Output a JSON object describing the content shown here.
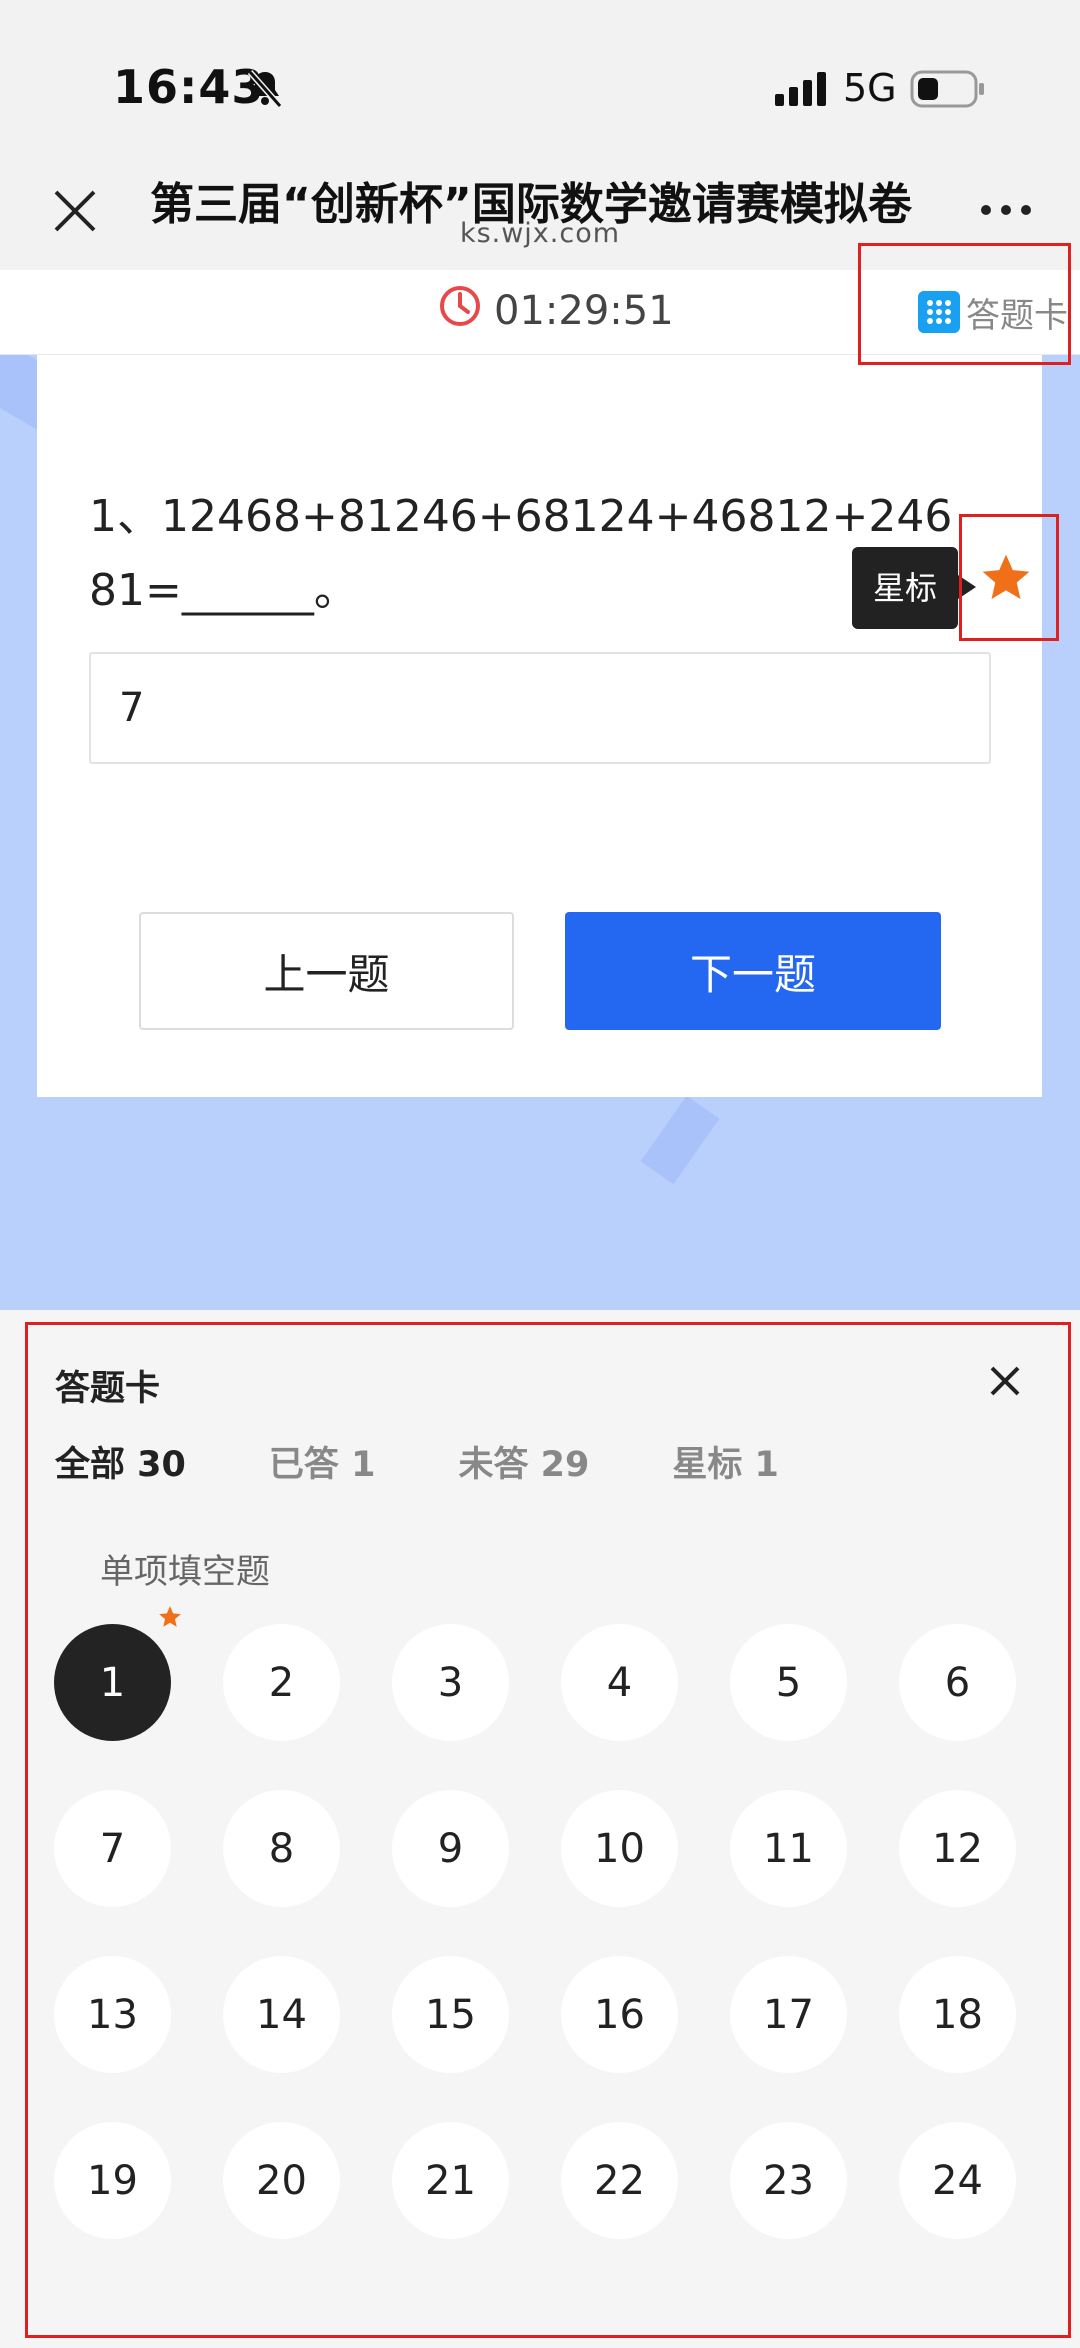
{
  "status_bar": {
    "time": "16:43",
    "network": "5G"
  },
  "nav": {
    "title": "第三届“创新杯”国际数学邀请赛模拟卷",
    "url": "ks.wjx.com"
  },
  "timer": {
    "value": "01:29:51",
    "card_label": "答题卡"
  },
  "question": {
    "text": "1、12468+81246+68124+46812+24681=______。",
    "answer_value": "7",
    "prev_label": "上一题",
    "next_label": "下一题",
    "star_tooltip": "星标"
  },
  "sheet": {
    "title": "答题卡",
    "tabs": [
      {
        "label": "全部 30",
        "active": true
      },
      {
        "label": "已答 1",
        "active": false
      },
      {
        "label": "未答 29",
        "active": false
      },
      {
        "label": "星标 1",
        "active": false
      }
    ],
    "section": "单项填空题",
    "questions": [
      "1",
      "2",
      "3",
      "4",
      "5",
      "6",
      "7",
      "8",
      "9",
      "10",
      "11",
      "12",
      "13",
      "14",
      "15",
      "16",
      "17",
      "18",
      "19",
      "20",
      "21",
      "22",
      "23",
      "24"
    ],
    "current_question": "1",
    "starred_questions": [
      "1"
    ]
  },
  "colors": {
    "primary": "#2468f2",
    "star": "#f07019",
    "annotation": "#e02020",
    "timer_icon": "#e84848",
    "background_blue": "#b9cffc"
  }
}
